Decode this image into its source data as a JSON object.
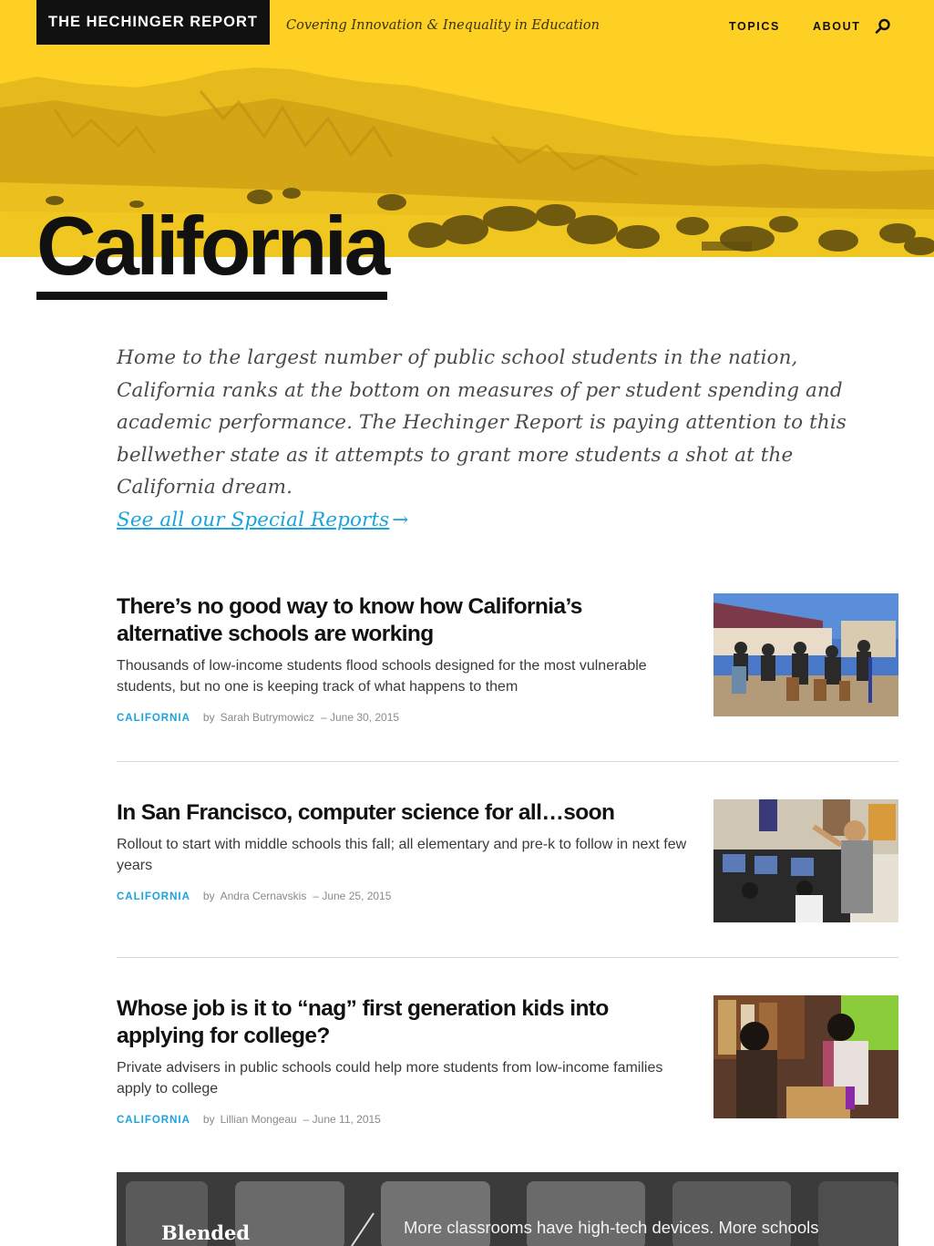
{
  "header": {
    "logo": "THE HECHINGER REPORT",
    "tagline": "Covering Innovation & Inequality in Education",
    "nav": [
      "TOPICS",
      "ABOUT"
    ],
    "search_icon": "search-icon"
  },
  "page": {
    "title": "California",
    "intro": "Home to the largest number of public school students in the nation, California ranks at the bottom on measures of per student spending and academic performance. The Hechinger Report is paying attention to this bellwether state as it attempts to grant more students a shot at the California dream.",
    "special_link": "See all our Special Reports",
    "special_link_arrow": "→"
  },
  "articles": [
    {
      "headline": "There’s no good way to know how California’s alternative schools are working",
      "dek": "Thousands of low-income students flood schools designed for the most vulnerable students, but no one is keeping track of what happens to them",
      "tag": "CALIFORNIA",
      "by": "by",
      "author": "Sarah Butrymowicz",
      "date": "– June 30, 2015"
    },
    {
      "headline": "In San Francisco, computer science for all…soon",
      "dek": "Rollout to start with middle schools this fall; all elementary and pre-k to follow in next few years",
      "tag": "CALIFORNIA",
      "by": "by",
      "author": "Andra Cernavskis",
      "date": "– June 25, 2015"
    },
    {
      "headline": "Whose job is it to “nag” first generation kids into applying for college?",
      "dek": "Private advisers in public schools could help more students from low-income families apply to college",
      "tag": "CALIFORNIA",
      "by": "by",
      "author": "Lillian Mongeau",
      "date": "– June 11, 2015"
    }
  ],
  "feature": {
    "title": "Blended",
    "text": "More classrooms have high-tech devices. More schools"
  },
  "colors": {
    "hero_yellow": "#fdd023",
    "link_blue": "#1aa3dc",
    "ink": "#111111"
  }
}
